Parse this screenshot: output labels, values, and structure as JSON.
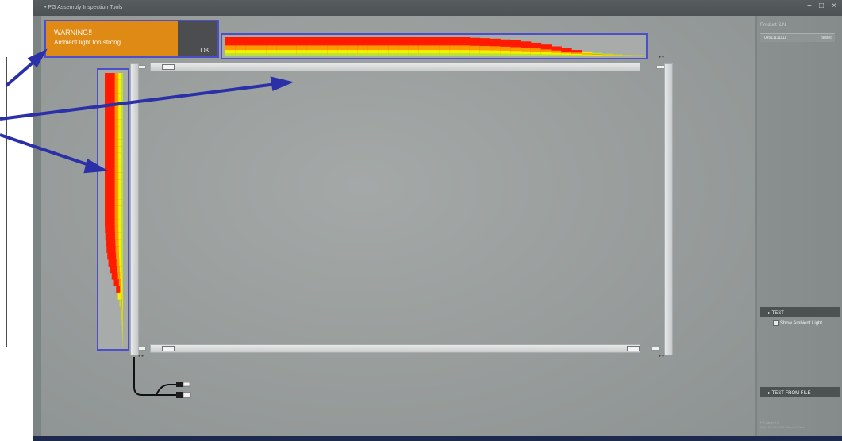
{
  "window": {
    "title": "• PG Assembly Inspection Tools",
    "controls": {
      "minimize": "−",
      "maximize": "□",
      "close": "×"
    }
  },
  "warning": {
    "heading": "WARNING!!",
    "message": "Ambient light too strong.",
    "ok_label": "OK",
    "bg_color": "#e08a16"
  },
  "panel": {
    "product_sn_label": "Product S/N",
    "serial": "04511111111",
    "status": "tested",
    "test_header": "▸ TEST",
    "ambient_checkbox_label": "Show Ambient Light",
    "ambient_checked": true,
    "test_from_file_header": "▸ TEST FROM FILE",
    "footer_line1": "PG Label 0.0",
    "footer_line2": "0000 00 00:0:0:0    Status   0 Pass"
  },
  "histograms": {
    "top_profile": [
      1.0,
      1.0,
      1.0,
      1.0,
      1.0,
      1.0,
      1.0,
      1.0,
      1.0,
      1.0,
      1.0,
      1.0,
      1.0,
      1.0,
      1.0,
      1.0,
      1.0,
      1.0,
      1.0,
      1.0,
      1.0,
      1.0,
      1.0,
      1.0,
      0.97,
      0.95,
      0.92,
      0.88,
      0.83,
      0.77,
      0.7,
      0.6,
      0.5,
      0.4,
      0.3,
      0.22,
      0.15,
      0.1,
      0.06,
      0.03,
      0.02
    ],
    "left_profile": [
      1.0,
      1.0,
      1.0,
      1.0,
      1.0,
      1.0,
      1.0,
      1.0,
      1.0,
      1.0,
      1.0,
      1.0,
      1.0,
      1.0,
      1.0,
      1.0,
      1.0,
      1.0,
      1.0,
      1.0,
      1.0,
      1.0,
      1.0,
      0.99,
      0.97,
      0.94,
      0.9,
      0.86,
      0.8,
      0.72,
      0.62,
      0.5,
      0.38,
      0.28,
      0.2,
      0.14,
      0.1,
      0.07,
      0.05,
      0.03,
      0.02
    ],
    "colors": {
      "strong": "#ff1a00",
      "mid": "#ff9a00",
      "weak": "#f2f200",
      "low": "#b4e23a"
    }
  },
  "annotation_color": "#2b2fa8"
}
